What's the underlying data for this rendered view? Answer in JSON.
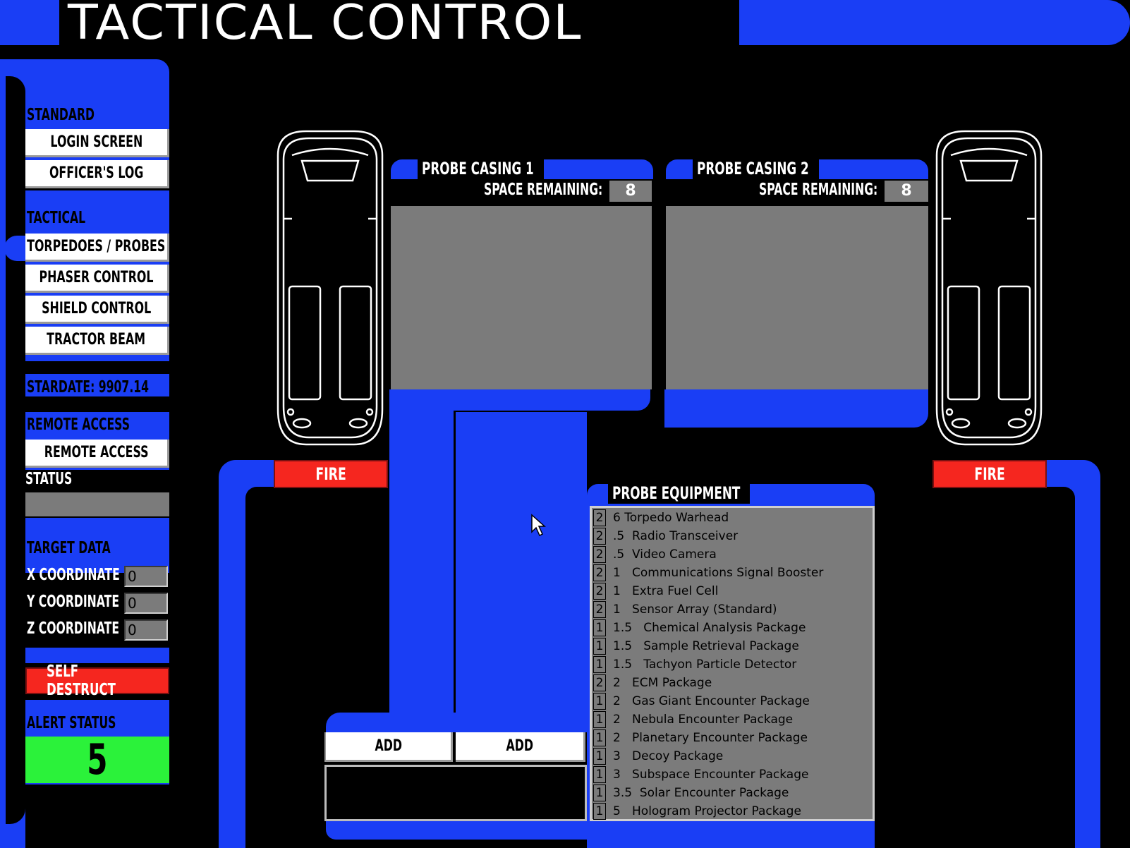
{
  "title": "TACTICAL CONTROL",
  "sidebar": {
    "standard_heading": "STANDARD",
    "login_screen": "LOGIN SCREEN",
    "officers_log": "OFFICER'S LOG",
    "tactical_heading": "TACTICAL",
    "torpedoes_probes": "TORPEDOES / PROBES",
    "phaser_control": "PHASER CONTROL",
    "shield_control": "SHIELD CONTROL",
    "tractor_beam": "TRACTOR BEAM",
    "stardate": "STARDATE: 9907.14",
    "remote_access_heading": "REMOTE ACCESS",
    "remote_access_button": "REMOTE ACCESS",
    "status_label": "STATUS",
    "status_value": "",
    "target_data_heading": "TARGET DATA",
    "x_label": "X COORDINATE",
    "x_value": "0",
    "y_label": "Y COORDINATE",
    "y_value": "0",
    "z_label": "Z COORDINATE",
    "z_value": "0",
    "self_destruct": "SELF DESTRUCT",
    "alert_status_heading": "ALERT STATUS",
    "alert_status_value": "5"
  },
  "probe1": {
    "title": "PROBE CASING 1",
    "space_label": "SPACE REMAINING:",
    "space_value": "8"
  },
  "probe2": {
    "title": "PROBE CASING 2",
    "space_label": "SPACE REMAINING:",
    "space_value": "8"
  },
  "fire_left": "FIRE",
  "fire_right": "FIRE",
  "add_left": "ADD",
  "add_right": "ADD",
  "equipment": {
    "heading": "PROBE EQUIPMENT",
    "items": [
      {
        "qty": "2",
        "name": "6 Torpedo Warhead"
      },
      {
        "qty": "2",
        "name": ".5  Radio Transceiver"
      },
      {
        "qty": "2",
        "name": ".5  Video Camera"
      },
      {
        "qty": "2",
        "name": "1   Communications Signal Booster"
      },
      {
        "qty": "2",
        "name": "1   Extra Fuel Cell"
      },
      {
        "qty": "2",
        "name": "1   Sensor Array (Standard)"
      },
      {
        "qty": "1",
        "name": "1.5   Chemical Analysis Package"
      },
      {
        "qty": "1",
        "name": "1.5   Sample Retrieval Package"
      },
      {
        "qty": "1",
        "name": "1.5   Tachyon Particle Detector"
      },
      {
        "qty": "2",
        "name": "2   ECM Package"
      },
      {
        "qty": "1",
        "name": "2   Gas Giant Encounter Package"
      },
      {
        "qty": "1",
        "name": "2   Nebula Encounter Package"
      },
      {
        "qty": "1",
        "name": "2   Planetary Encounter Package"
      },
      {
        "qty": "1",
        "name": "3   Decoy Package"
      },
      {
        "qty": "1",
        "name": "3   Subspace Encounter Package"
      },
      {
        "qty": "1",
        "name": "3.5  Solar Encounter Package"
      },
      {
        "qty": "1",
        "name": "5   Hologram Projector Package"
      }
    ]
  },
  "colors": {
    "blue": "#1a3ef5",
    "red": "#f5261f",
    "green": "#2bf23a",
    "gray": "#7b7b7b"
  }
}
